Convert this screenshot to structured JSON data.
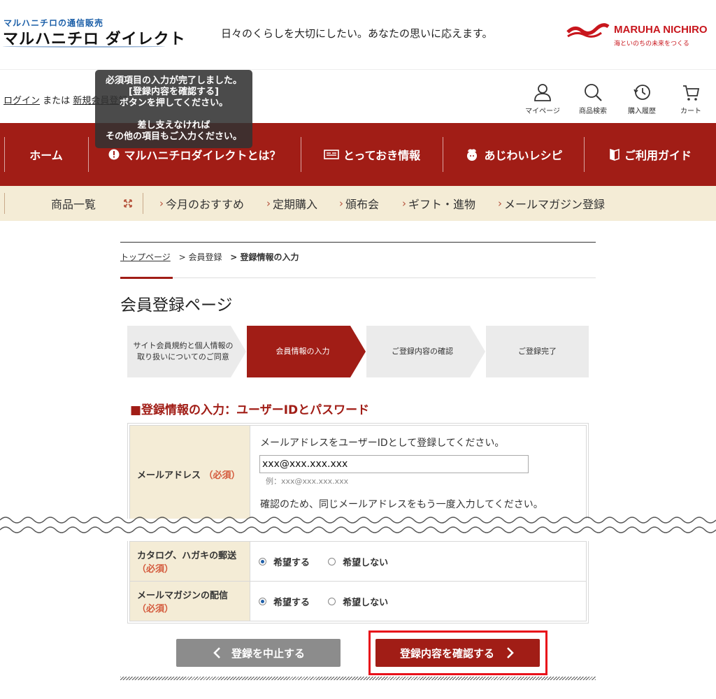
{
  "header": {
    "logo_sub": "マルハニチロの通信販売",
    "logo_main": "マルハニチロ ダイレクト",
    "tagline": "日々のくらしを大切にしたい。あなたの思いに応えます。",
    "brand_name": "MARUHA NICHIRO",
    "brand_slogan": "海といのちの未来をつくる"
  },
  "login": {
    "login_link": "ログイン",
    "or_text": "または",
    "register_link": "新規会員登録"
  },
  "tooltip": {
    "line1": "必須項目の入力が完了しました。",
    "line2": "[登録内容を確認する]",
    "line3": "ボタンを押してください。",
    "line4": "差し支えなければ",
    "line5": "その他の項目もご入力ください。"
  },
  "utility": [
    {
      "label": "マイページ",
      "icon": "person-icon"
    },
    {
      "label": "商品検索",
      "icon": "search-icon"
    },
    {
      "label": "購入履歴",
      "icon": "history-icon"
    },
    {
      "label": "カート",
      "icon": "cart-icon"
    }
  ],
  "main_nav": [
    {
      "label": "ホーム"
    },
    {
      "label": "マルハニチロダイレクトとは？",
      "icon": "exclamation-icon"
    },
    {
      "label": "とっておき情報",
      "icon": "newspaper-icon"
    },
    {
      "label": "あじわいレシピ",
      "icon": "chef-icon"
    },
    {
      "label": "ご利用ガイド",
      "icon": "book-icon"
    }
  ],
  "sub_nav": [
    {
      "label": "商品一覧"
    },
    {
      "label": "今月のおすすめ"
    },
    {
      "label": "定期購入"
    },
    {
      "label": "頒布会"
    },
    {
      "label": "ギフト・進物"
    },
    {
      "label": "メールマガジン登録"
    }
  ],
  "breadcrumb": {
    "top": "トップページ",
    "sep1": "> 会員登録",
    "current": "> 登録情報の入力"
  },
  "page_title": "会員登録ページ",
  "steps": [
    {
      "line1": "サイト会員規約と個人情報の",
      "line2": "取り扱いについてのご同意"
    },
    {
      "line1": "会員情報の入力",
      "line2": ""
    },
    {
      "line1": "ご登録内容の確認",
      "line2": ""
    },
    {
      "line1": "ご登録完了",
      "line2": ""
    }
  ],
  "section_heading": "■登録情報の入力：ユーザーIDとパスワード",
  "email": {
    "label": "メールアドレス",
    "required": "（必須）",
    "instruction": "メールアドレスをユーザーIDとして登録してください。",
    "value": "xxx@xxx.xxx.xxx",
    "example": "例：xxx@xxx.xxx.xxx",
    "confirm_instruction": "確認のため、同じメールアドレスをもう一度入力してください。"
  },
  "catalog": {
    "label": "カタログ、ハガキの郵送",
    "required": "（必須）",
    "opt_yes": "希望する",
    "opt_no": "希望しない"
  },
  "mailmag": {
    "label": "メールマガジンの配信",
    "required": "（必須）",
    "opt_yes": "希望する",
    "opt_no": "希望しない"
  },
  "buttons": {
    "cancel": "登録を中止する",
    "confirm": "登録内容を確認する"
  },
  "colors": {
    "brand_red": "#a11d16",
    "beige": "#f4ecd6",
    "highlight": "#e8101a"
  }
}
